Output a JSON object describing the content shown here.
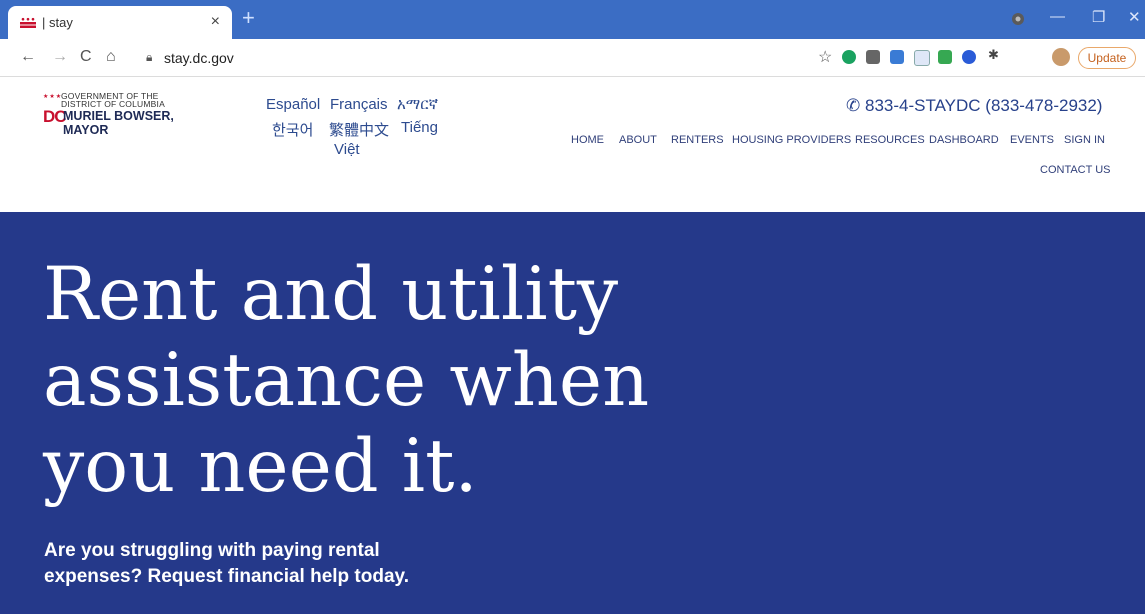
{
  "browser": {
    "tab_title": "| stay",
    "tab_close": "×",
    "new_tab": "+",
    "url": "stay.dc.gov",
    "update_label": "Update",
    "minimize": "—",
    "maximize": "❐",
    "close": "✕",
    "nav": {
      "back": "←",
      "forward": "→",
      "reload": "C",
      "home": "⌂",
      "bookmark": "☆"
    }
  },
  "site": {
    "logo": {
      "line1": "GOVERNMENT OF THE",
      "line2": "DISTRICT OF COLUMBIA",
      "dc": "DC",
      "mayor": "MURIEL BOWSER, MAYOR"
    },
    "languages": [
      "Español",
      "Français",
      "አማርኛ",
      "한국어",
      "繁體中文",
      "Tiếng",
      "Việt"
    ],
    "phone": "833-4-STAYDC (833-478-2932)",
    "nav": [
      "HOME",
      "ABOUT",
      "RENTERS",
      "HOUSING PROVIDERS",
      "RESOURCES",
      "DASHBOARD",
      "EVENTS",
      "SIGN IN",
      "CONTACT US"
    ]
  },
  "hero": {
    "title_lines": [
      "Rent and utility",
      "assistance when",
      "you need it."
    ],
    "subtitle_lines": [
      "Are you struggling with paying rental",
      "expenses? Request financial help today."
    ]
  },
  "colors": {
    "hero_bg": "#25398a",
    "tabbar": "#3b6dc4",
    "nav_text": "#31407a",
    "brand_red": "#c8102e"
  }
}
